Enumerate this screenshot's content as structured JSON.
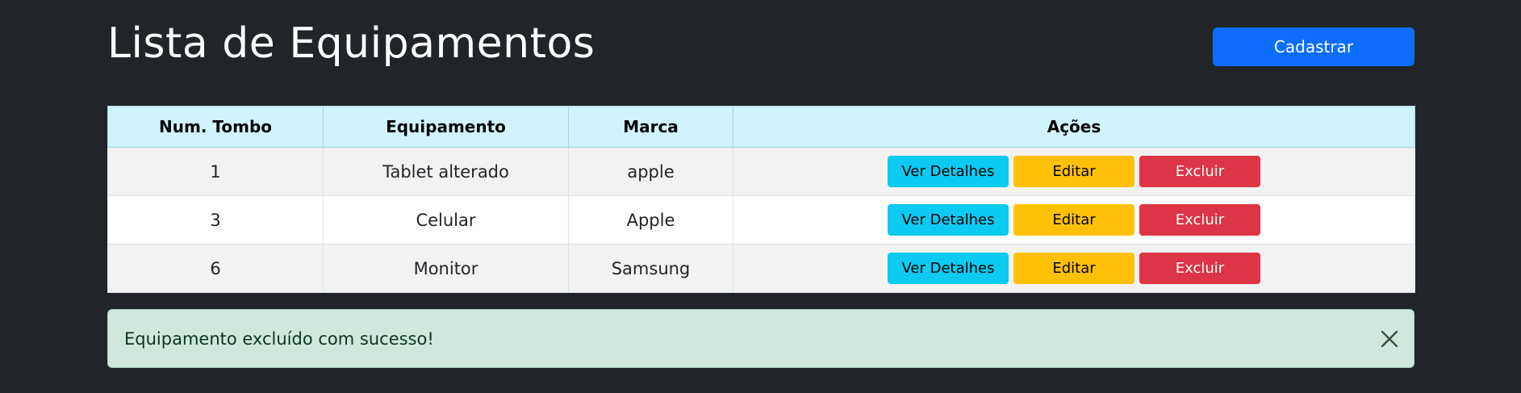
{
  "header": {
    "title": "Lista de Equipamentos",
    "register_label": "Cadastrar"
  },
  "table": {
    "columns": [
      "Num. Tombo",
      "Equipamento",
      "Marca",
      "Ações"
    ],
    "rows": [
      {
        "tombo": "1",
        "equipamento": "Tablet alterado",
        "marca": "apple"
      },
      {
        "tombo": "3",
        "equipamento": "Celular",
        "marca": "Apple"
      },
      {
        "tombo": "6",
        "equipamento": "Monitor",
        "marca": "Samsung"
      }
    ],
    "actions": {
      "details_label": "Ver Detalhes",
      "edit_label": "Editar",
      "delete_label": "Excluir"
    }
  },
  "alert": {
    "message": "Equipamento excluído com sucesso!",
    "close_icon": "close-icon"
  },
  "colors": {
    "background": "#212529",
    "primary": "#0d6efd",
    "info": "#0dcaf0",
    "warning": "#ffc107",
    "danger": "#dc3545",
    "success_bg": "#d1e7dd"
  }
}
